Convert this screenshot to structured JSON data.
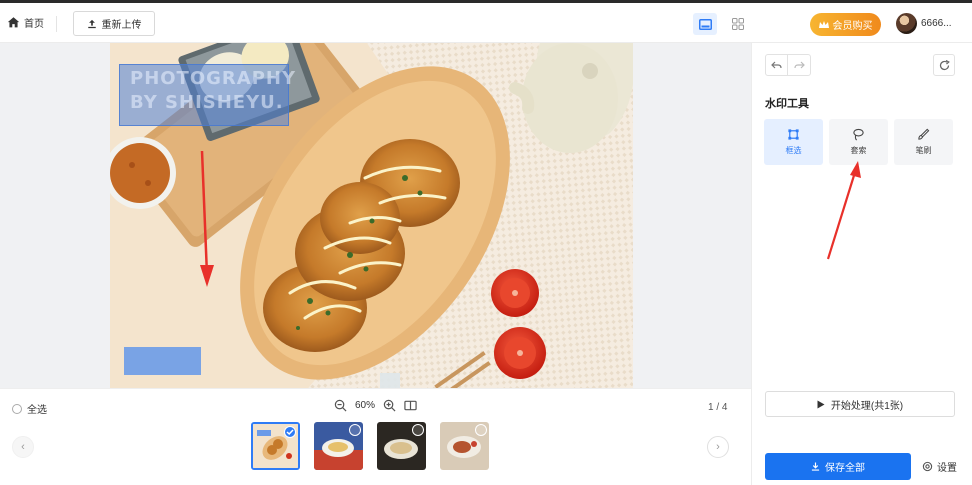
{
  "header": {
    "home_label": "首页",
    "reupload_label": "重新上传",
    "vip_label": "会员购买",
    "username": "6666..."
  },
  "canvas": {
    "watermark_text_line1": "PHOTOGRAPHY",
    "watermark_text_line2": "BY SHISHEYU."
  },
  "bottom": {
    "select_all_label": "全选",
    "zoom_level": "60%",
    "page_indicator": "1 / 4",
    "thumbnails": [
      {
        "name": "fried-chicken",
        "selected": true
      },
      {
        "name": "dish-blue-bg",
        "selected": false
      },
      {
        "name": "noodle-dish",
        "selected": false
      },
      {
        "name": "meat-dish",
        "selected": false
      }
    ]
  },
  "panel": {
    "title": "水印工具",
    "tools": [
      {
        "label": "框选",
        "icon": "box-select-icon",
        "active": true
      },
      {
        "label": "套索",
        "icon": "lasso-icon",
        "active": false
      },
      {
        "label": "笔刷",
        "icon": "brush-icon",
        "active": false
      }
    ],
    "start_label": "开始处理(共1张)",
    "save_label": "保存全部",
    "settings_label": "设置"
  },
  "colors": {
    "accent": "#1a73f0",
    "vip_orange": "#f29a22",
    "annotation_red": "#e8302a",
    "selection_blue": "#5b8fe0"
  }
}
